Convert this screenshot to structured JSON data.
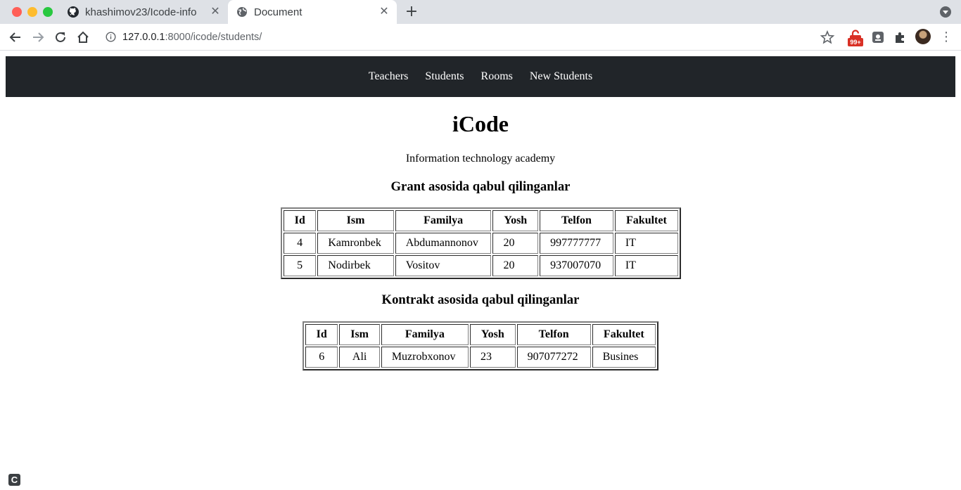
{
  "browser": {
    "tabs": [
      {
        "title": "khashimov23/Icode-info",
        "icon": "github-icon"
      },
      {
        "title": "Document",
        "icon": "globe-icon"
      }
    ],
    "url_host": "127.0.0.1",
    "url_path": ":8000/icode/students/",
    "extension_badge": "99+"
  },
  "nav": {
    "items": [
      {
        "label": "Teachers"
      },
      {
        "label": "Students"
      },
      {
        "label": "Rooms"
      },
      {
        "label": "New Students"
      }
    ]
  },
  "header": {
    "title": "iCode",
    "subtitle": "Information technology academy"
  },
  "grant": {
    "title": "Grant asosida qabul qilinganlar",
    "columns": [
      "Id",
      "Ism",
      "Familya",
      "Yosh",
      "Telfon",
      "Fakultet"
    ],
    "rows": [
      [
        "4",
        "Kamronbek",
        "Abdumannonov",
        "20",
        "997777777",
        "IT"
      ],
      [
        "5",
        "Nodirbek",
        "Vositov",
        "20",
        "937007070",
        "IT"
      ]
    ]
  },
  "kontrakt": {
    "title": "Kontrakt asosida qabul qilinganlar",
    "columns": [
      "Id",
      "Ism",
      "Familya",
      "Yosh",
      "Telfon",
      "Fakultet"
    ],
    "rows": [
      [
        "6",
        "Ali",
        "Muzrobxonov",
        "23",
        "907077272",
        "Busines"
      ]
    ]
  },
  "corner_icon": "C"
}
